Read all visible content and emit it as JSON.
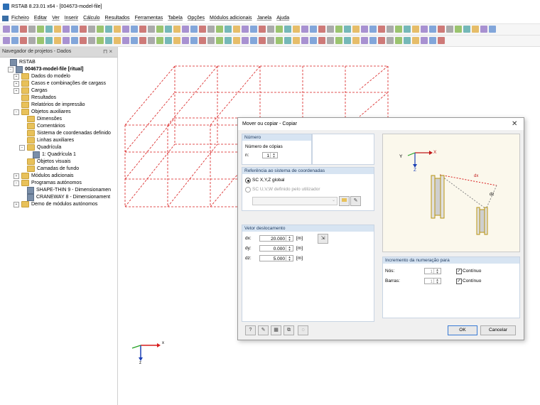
{
  "window": {
    "title": "RSTAB 8.23.01 x64 - [004673-model-file]"
  },
  "menu": [
    "Ficheiro",
    "Editar",
    "Ver",
    "Inserir",
    "Cálculo",
    "Resultados",
    "Ferramentas",
    "Tabela",
    "Opções",
    "Módulos adicionais",
    "Janela",
    "Ajuda"
  ],
  "navigator": {
    "title": "Navegador de projetos - Dados",
    "pin": "⊓ ×",
    "items": [
      {
        "label": "RSTAB",
        "level": 0,
        "kind": "app",
        "exp": ""
      },
      {
        "label": "004673-model-file [ritual]",
        "level": 1,
        "kind": "app",
        "exp": "−",
        "bold": true
      },
      {
        "label": "Dados do modelo",
        "level": 2,
        "kind": "folder",
        "exp": "+"
      },
      {
        "label": "Casos e combinações de cargass",
        "level": 2,
        "kind": "folder",
        "exp": "+"
      },
      {
        "label": "Cargas",
        "level": 2,
        "kind": "folder",
        "exp": "+"
      },
      {
        "label": "Resultados",
        "level": 2,
        "kind": "folder",
        "exp": ""
      },
      {
        "label": "Relatórios de impressão",
        "level": 2,
        "kind": "folder",
        "exp": ""
      },
      {
        "label": "Objetos auxiliares",
        "level": 2,
        "kind": "folder",
        "exp": "−"
      },
      {
        "label": "Dimensões",
        "level": 3,
        "kind": "folder",
        "exp": ""
      },
      {
        "label": "Comentários",
        "level": 3,
        "kind": "folder",
        "exp": ""
      },
      {
        "label": "Sistema de coordenadas definido",
        "level": 3,
        "kind": "folder",
        "exp": ""
      },
      {
        "label": "Linhas auxiliares",
        "level": 3,
        "kind": "folder",
        "exp": ""
      },
      {
        "label": "Quadrícula",
        "level": 3,
        "kind": "folder",
        "exp": "−"
      },
      {
        "label": "1: Quadrícula 1",
        "level": 4,
        "kind": "app",
        "exp": ""
      },
      {
        "label": "Objetos visuais",
        "level": 3,
        "kind": "folder",
        "exp": ""
      },
      {
        "label": "Camadas de fundo",
        "level": 3,
        "kind": "folder",
        "exp": ""
      },
      {
        "label": "Módulos adicionais",
        "level": 2,
        "kind": "folder",
        "exp": "+"
      },
      {
        "label": "Programas autónomos",
        "level": 2,
        "kind": "folder",
        "exp": "−"
      },
      {
        "label": "SHAPE-THIN 9 - Dimensionamen",
        "level": 3,
        "kind": "app",
        "exp": ""
      },
      {
        "label": "CRANEWAY 8 - Dimensionament",
        "level": 3,
        "kind": "app",
        "exp": ""
      },
      {
        "label": "Demo de módulos autónomos",
        "level": 2,
        "kind": "folder",
        "exp": "+"
      }
    ]
  },
  "axes": {
    "x": "x",
    "z": "z"
  },
  "dialog": {
    "title": "Mover ou copiar - Copiar",
    "close": "✕",
    "numero": {
      "header": "Número",
      "label": "Número de cópias",
      "n_label": "n:",
      "n_value": "1"
    },
    "ref": {
      "header": "Referência ao sistema de coordenadas",
      "opt1": "SC X,Y,Z global",
      "opt2": "SC U,V,W definido pelo utilizador"
    },
    "vetor": {
      "header": "Vetor deslocamento",
      "dx_label": "dx:",
      "dx_value": "20.000",
      "dx_unit": "[m]",
      "dy_label": "dy:",
      "dy_value": "0.000",
      "dy_unit": "[m]",
      "dz_label": "dz:",
      "dz_value": "5.000",
      "dz_unit": "[m]"
    },
    "preview": {
      "y": "Y",
      "x": "X",
      "z": "Z",
      "dx": "dx",
      "dz": "dz"
    },
    "incr": {
      "header": "Incremento da numeração para",
      "nos_label": "Nós:",
      "nos_value": "1",
      "nos_check": "Contínuo",
      "barras_label": "Barras:",
      "barras_value": "1",
      "barras_check": "Contínuo"
    },
    "ok": "OK",
    "cancel": "Cancelar"
  }
}
